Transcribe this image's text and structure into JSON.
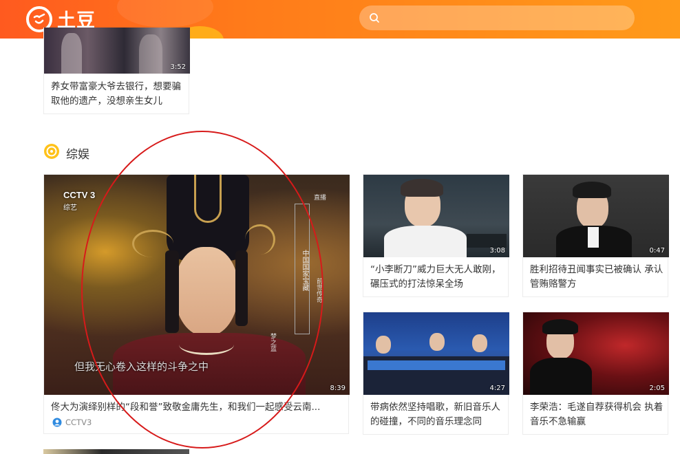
{
  "header": {
    "logo_text": "土豆",
    "search_placeholder": ""
  },
  "top_video": {
    "duration": "3:52",
    "title": "养女带富豪大爷去银行，想要骗取他的遗产，没想亲生女儿"
  },
  "section": {
    "title": "综娱"
  },
  "feature_video": {
    "duration": "8:39",
    "title": "佟大为演绎别样的“段和誉”致敬金庸先生，和我们一起感受云南...",
    "channel": "CCTV3",
    "overlay_logo": "CCTV 3",
    "overlay_sub": "综艺",
    "overlay_right": "梦之蓝",
    "subtitle": "但我无心卷入这样的斗争之中",
    "vertical_caption": "中国国家宝藏",
    "vertical_caption_2": "前世传奇",
    "corner_tag": "直播"
  },
  "videos": [
    {
      "duration": "3:08",
      "title": "“小李断刀”威力巨大无人敢刚，碾压式的打法惊呆全场"
    },
    {
      "duration": "0:47",
      "title": "胜利招待丑闻事实已被确认 承认管贿赂警方"
    },
    {
      "duration": "4:27",
      "title": "带病依然坚持唱歌，新旧音乐人的碰撞，不同的音乐理念同"
    },
    {
      "duration": "2:05",
      "title": "李荣浩：毛遂自荐获得机会 执着音乐不急输赢"
    }
  ],
  "colors": {
    "header_orange": "#ff7a1a",
    "annotation_red": "#d71a1a"
  }
}
